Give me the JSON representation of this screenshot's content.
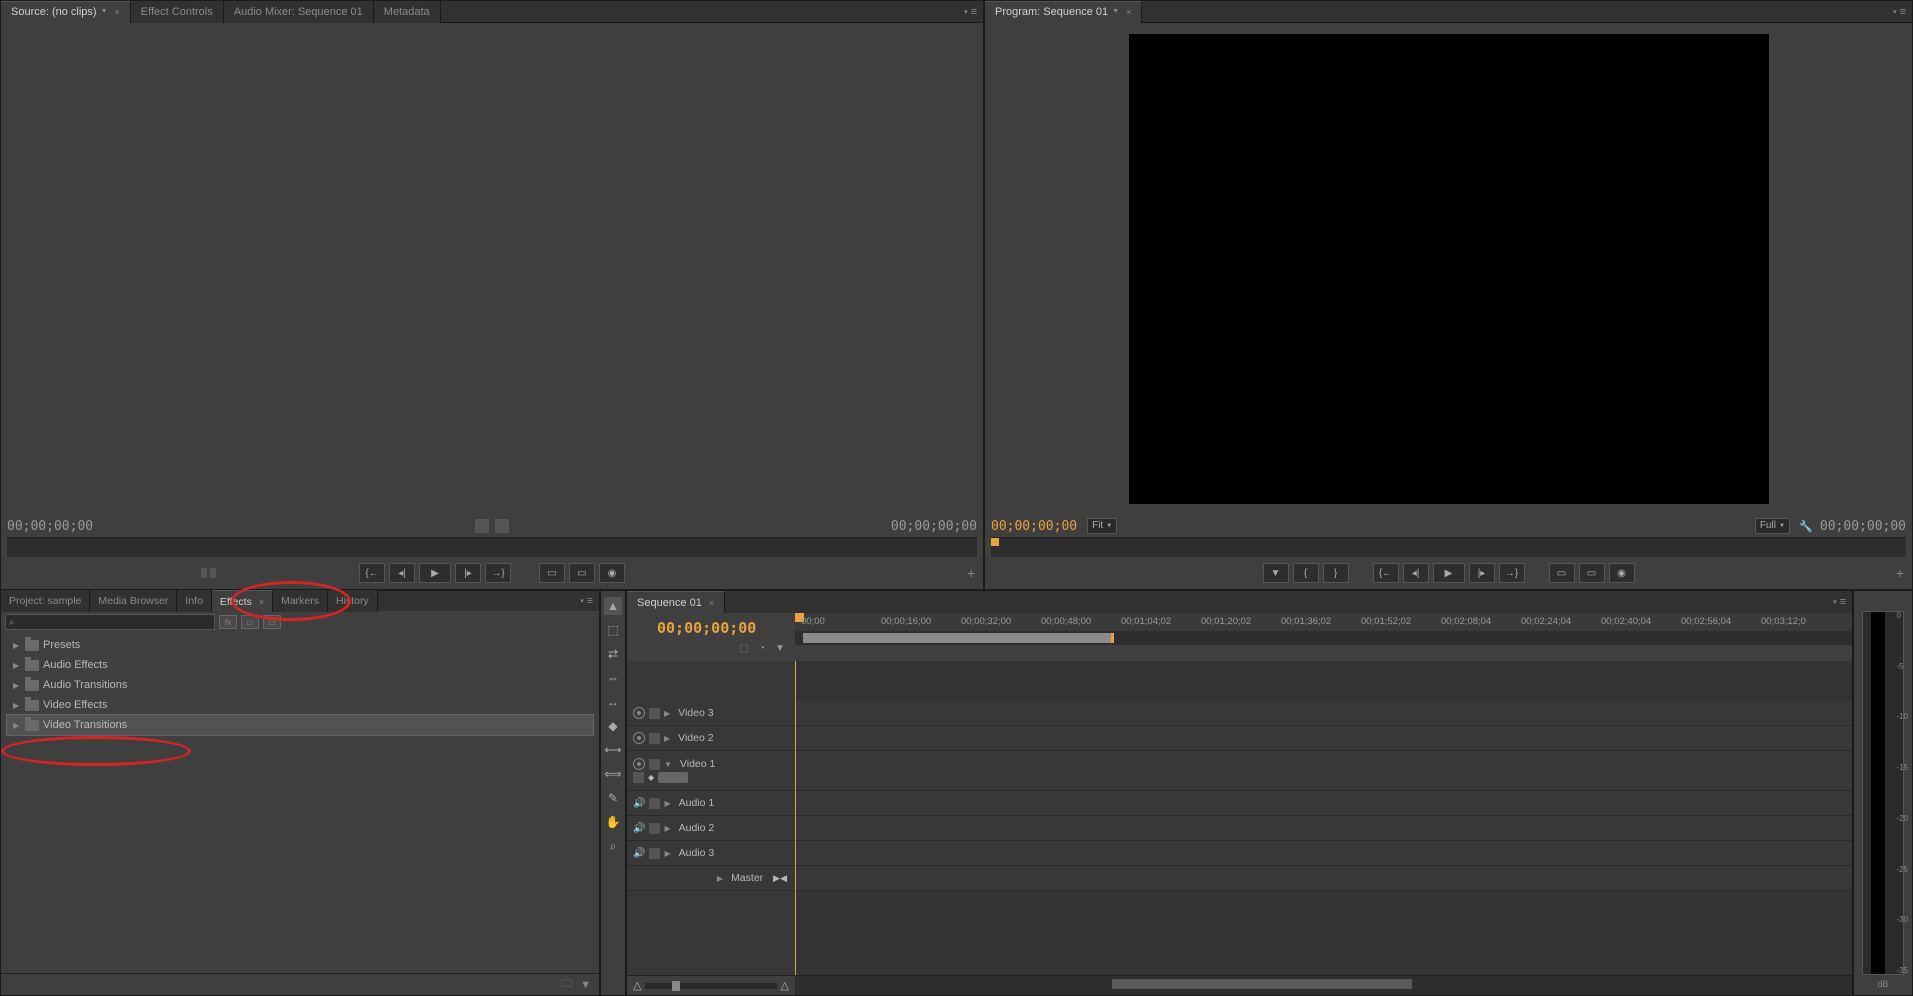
{
  "source": {
    "tabs": [
      {
        "label": "Source: (no clips)",
        "active": true,
        "dropdown": true
      },
      {
        "label": "Effect Controls"
      },
      {
        "label": "Audio Mixer: Sequence 01"
      },
      {
        "label": "Metadata"
      }
    ],
    "timecode_left": "00;00;00;00",
    "timecode_right": "00;00;00;00"
  },
  "program": {
    "tab": "Program: Sequence 01",
    "timecode_left": "00;00;00;00",
    "fit_label": "Fit",
    "full_label": "Full",
    "timecode_right": "00;00;00;00"
  },
  "effects_panel": {
    "tabs": [
      {
        "label": "Project: sample"
      },
      {
        "label": "Media Browser"
      },
      {
        "label": "Info"
      },
      {
        "label": "Effects",
        "active": true,
        "closeable": true
      },
      {
        "label": "Markers"
      },
      {
        "label": "History"
      }
    ],
    "search_placeholder": "",
    "folders": [
      {
        "label": "Presets"
      },
      {
        "label": "Audio Effects"
      },
      {
        "label": "Audio Transitions"
      },
      {
        "label": "Video Effects"
      },
      {
        "label": "Video Transitions",
        "selected": true
      }
    ]
  },
  "timeline": {
    "tab": "Sequence 01",
    "timecode": "00;00;00;00",
    "ruler": [
      "00;00",
      "00;00;16;00",
      "00;00;32;00",
      "00;00;48;00",
      "00;01;04;02",
      "00;01;20;02",
      "00;01;36;02",
      "00;01;52;02",
      "00;02;08;04",
      "00;02;24;04",
      "00;02;40;04",
      "00;02;56;04",
      "00;03;12;0"
    ],
    "tracks": [
      {
        "id": "v3",
        "label": "Video 3",
        "type": "video"
      },
      {
        "id": "v2",
        "label": "Video 2",
        "type": "video"
      },
      {
        "id": "v1",
        "label": "Video 1",
        "type": "video",
        "expanded": true
      },
      {
        "id": "a1",
        "label": "Audio 1",
        "type": "audio",
        "expanded": true
      },
      {
        "id": "a2",
        "label": "Audio 2",
        "type": "audio"
      },
      {
        "id": "a3",
        "label": "Audio 3",
        "type": "audio"
      },
      {
        "id": "master",
        "label": "Master",
        "type": "master"
      }
    ]
  },
  "meter": {
    "ticks": [
      "0",
      "-5",
      "-10",
      "-15",
      "-20",
      "-25",
      "-30",
      "-35"
    ],
    "unit": "dB"
  },
  "tools": [
    "selection",
    "track-select",
    "ripple",
    "rolling",
    "rate-stretch",
    "razor",
    "slip",
    "slide",
    "pen",
    "hand",
    "zoom"
  ]
}
